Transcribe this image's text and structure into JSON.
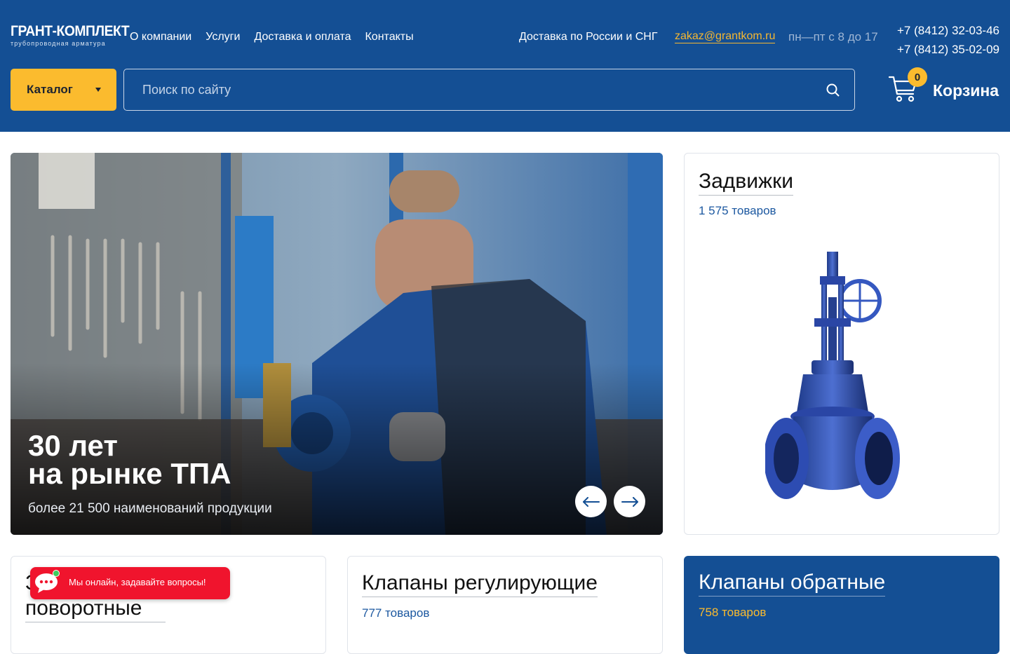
{
  "logo": {
    "name": "ГРАНТ-КОМПЛЕКТ",
    "tagline": "трубопроводная арматура"
  },
  "nav": [
    {
      "label": "О компании"
    },
    {
      "label": "Услуги"
    },
    {
      "label": "Доставка и оплата"
    },
    {
      "label": "Контакты"
    }
  ],
  "header_info": {
    "delivery": "Доставка по России и СНГ",
    "email": "zakaz@grantkom.ru",
    "hours": "пн—пт с 8 до 17",
    "phones": [
      "+7 (8412) 32-03-46",
      "+7 (8412) 35-02-09"
    ]
  },
  "catalog": {
    "label": "Каталог"
  },
  "search": {
    "placeholder": "Поиск по сайту"
  },
  "cart": {
    "label": "Корзина",
    "count": "0"
  },
  "hero": {
    "title": "30 лет\nна рынке ТПА",
    "subtitle": "более 21 500 наименований продукции"
  },
  "categories": [
    {
      "title": "Задвижки",
      "count": "1 575 товаров"
    },
    {
      "title": "Затворы поворотные",
      "count": ""
    },
    {
      "title": "Клапаны регулирующие",
      "count": "777 товаров"
    },
    {
      "title": "Клапаны обратные",
      "count": "758 товаров"
    }
  ],
  "chat": {
    "text": "Мы онлайн, задавайте вопросы!"
  },
  "colors": {
    "brand": "#144f94",
    "accent": "#fbbb2e",
    "chat": "#f0142d"
  }
}
